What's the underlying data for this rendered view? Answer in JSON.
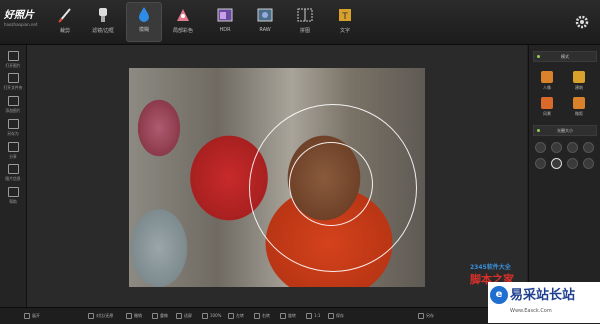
{
  "app": {
    "logo_title": "好照片",
    "logo_subtitle": "haozhaopian.net"
  },
  "toolbar": {
    "tools": [
      {
        "label": "裁剪",
        "icon": "crop-pen-icon",
        "active": false
      },
      {
        "label": "滤镜/边框",
        "icon": "filter-brush-icon",
        "active": false
      },
      {
        "label": "模糊",
        "icon": "blur-drop-icon",
        "active": true
      },
      {
        "label": "局部彩色",
        "icon": "partial-color-icon",
        "active": false
      },
      {
        "label": "HDR",
        "icon": "hdr-icon",
        "active": false
      },
      {
        "label": "RAW",
        "icon": "raw-icon",
        "active": false
      },
      {
        "label": "拼图",
        "icon": "collage-icon",
        "active": false
      },
      {
        "label": "文字",
        "icon": "text-icon",
        "active": false
      }
    ],
    "settings_icon": "gear-icon"
  },
  "sidebar": {
    "items": [
      {
        "label": "打开图片",
        "icon": "open-image-icon"
      },
      {
        "label": "打开文件夹",
        "icon": "open-folder-icon"
      },
      {
        "label": "添加图片",
        "icon": "add-image-icon"
      },
      {
        "label": "另存为",
        "icon": "save-as-icon"
      },
      {
        "label": "分享",
        "icon": "share-icon"
      },
      {
        "label": "图片信息",
        "icon": "image-info-icon"
      },
      {
        "label": "帮助",
        "icon": "help-icon"
      }
    ]
  },
  "right_panel": {
    "mode_header": "模式",
    "modes": [
      {
        "label": "人像",
        "icon": "portrait-icon",
        "color": "#d9822b"
      },
      {
        "label": "建筑",
        "icon": "building-icon",
        "color": "#d9a02b"
      },
      {
        "label": "风景",
        "icon": "landscape-icon",
        "color": "#d96a2b"
      },
      {
        "label": "微距",
        "icon": "macro-icon",
        "color": "#d9822b"
      }
    ],
    "size_header": "光圈大小"
  },
  "bottom_bar": {
    "buttons": [
      {
        "label": "展开",
        "icon": "expand-icon"
      },
      {
        "label": "对比/还原",
        "icon": "compare-icon"
      },
      {
        "label": "撤销",
        "icon": "undo-icon"
      },
      {
        "label": "重做",
        "icon": "redo-icon"
      },
      {
        "label": "适屏",
        "icon": "fit-screen-icon"
      },
      {
        "label": "100%",
        "icon": "actual-size-icon"
      },
      {
        "label": "左转",
        "icon": "rotate-left-icon"
      },
      {
        "label": "右转",
        "icon": "rotate-right-icon"
      },
      {
        "label": "旋转",
        "icon": "rotate-icon"
      },
      {
        "label": "1:1",
        "icon": "ratio-icon"
      },
      {
        "label": "保存",
        "icon": "save-icon"
      },
      {
        "label": "另存",
        "icon": "save-copy-icon"
      }
    ]
  },
  "watermarks": {
    "site_a": "2345软件大全",
    "site_a_cn": "脚本之家",
    "site_b": "易采站长站",
    "site_b_url": "Www.Easck.Com"
  }
}
